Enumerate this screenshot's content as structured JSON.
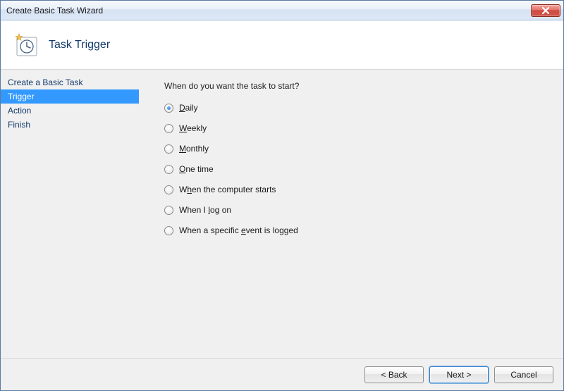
{
  "window": {
    "title": "Create Basic Task Wizard"
  },
  "header": {
    "page_title": "Task Trigger"
  },
  "sidebar": {
    "items": [
      {
        "label": "Create a Basic Task",
        "selected": false
      },
      {
        "label": "Trigger",
        "selected": true
      },
      {
        "label": "Action",
        "selected": false
      },
      {
        "label": "Finish",
        "selected": false
      }
    ]
  },
  "content": {
    "prompt": "When do you want the task to start?",
    "options": [
      {
        "pre": "",
        "accel": "D",
        "post": "aily",
        "checked": true
      },
      {
        "pre": "",
        "accel": "W",
        "post": "eekly",
        "checked": false
      },
      {
        "pre": "",
        "accel": "M",
        "post": "onthly",
        "checked": false
      },
      {
        "pre": "",
        "accel": "O",
        "post": "ne time",
        "checked": false
      },
      {
        "pre": "W",
        "accel": "h",
        "post": "en the computer starts",
        "checked": false
      },
      {
        "pre": "When I ",
        "accel": "l",
        "post": "og on",
        "checked": false
      },
      {
        "pre": "When a specific ",
        "accel": "e",
        "post": "vent is logged",
        "checked": false
      }
    ]
  },
  "footer": {
    "back": "< Back",
    "next": "Next >",
    "cancel": "Cancel"
  }
}
